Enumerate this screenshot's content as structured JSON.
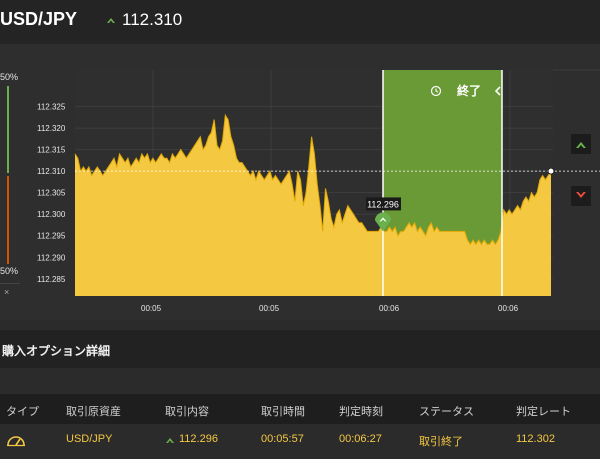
{
  "header": {
    "pair": "USD/JPY",
    "direction_icon": "up-arrow-icon",
    "current_rate": "112.310"
  },
  "gauge": {
    "top_label": "50%",
    "bottom_label": "50%",
    "close_label": "×",
    "high_color": "#6ab04c",
    "low_color": "#d35400"
  },
  "chart_data": {
    "type": "area",
    "y_ticks": [
      "112.325",
      "112.320",
      "112.315",
      "112.310",
      "112.305",
      "112.300",
      "112.295",
      "112.290",
      "112.285"
    ],
    "x_ticks": [
      "00:05",
      "00:05",
      "00:06",
      "00:06"
    ],
    "ylim": [
      112.281,
      112.3335
    ],
    "current_level": 112.31,
    "entry_marker_label": "112.296",
    "entry_value": 112.296,
    "expiry_panel_label": "終了",
    "area_color": "#f5c842",
    "expiry_panel_color": "#6a9a36",
    "series": [
      {
        "values": [
          112.314,
          112.313,
          112.31,
          112.311,
          112.31,
          112.311,
          112.309,
          112.31,
          112.311,
          112.31,
          112.309,
          112.31,
          112.311,
          112.312,
          112.313,
          112.311,
          112.314,
          112.313,
          112.312,
          112.313,
          112.311,
          112.312,
          112.313,
          112.312,
          112.314,
          112.313,
          112.314,
          112.312,
          112.313,
          112.312,
          112.313,
          112.314,
          112.313,
          112.313,
          112.312,
          112.314,
          112.313,
          112.314,
          112.315,
          112.314,
          112.313,
          112.314,
          112.315,
          112.316,
          112.317,
          112.318,
          112.315,
          112.316,
          112.318,
          112.319,
          112.322,
          112.316,
          112.315,
          112.317,
          112.323,
          112.322,
          112.318,
          112.316,
          112.313,
          112.312,
          112.312,
          112.311,
          112.31,
          112.309,
          112.31,
          112.308,
          112.31,
          112.309,
          112.308,
          112.309,
          112.31,
          112.308,
          112.309,
          112.308,
          112.307,
          112.308,
          112.309,
          112.31,
          112.307,
          112.303,
          112.31,
          112.308,
          112.302,
          112.305,
          112.311,
          112.318,
          112.314,
          112.307,
          112.302,
          112.296,
          112.306,
          112.303,
          112.299,
          112.297,
          112.3,
          112.301,
          112.298,
          112.3,
          112.302,
          112.301,
          112.3,
          112.299,
          112.298,
          112.298,
          112.297,
          112.296,
          112.296,
          112.296,
          112.296,
          112.296,
          112.297,
          112.296,
          112.296,
          112.297,
          112.296,
          112.297,
          112.295,
          112.296,
          112.296,
          112.297,
          112.298,
          112.297,
          112.298,
          112.296,
          112.297,
          112.296,
          112.295,
          112.297,
          112.298,
          112.296,
          112.297,
          112.296,
          112.296,
          112.296,
          112.296,
          112.296,
          112.296,
          112.296,
          112.296,
          112.296,
          112.296,
          112.294,
          112.293,
          112.294,
          112.293,
          112.294,
          112.293,
          112.294,
          112.293,
          112.293,
          112.294,
          112.293,
          112.294,
          112.296,
          112.301,
          112.3,
          112.301,
          112.3,
          112.301,
          112.302,
          112.301,
          112.303,
          112.304,
          112.303,
          112.305,
          112.304,
          112.305,
          112.308,
          112.309,
          112.308,
          112.309,
          112.31
        ]
      }
    ]
  },
  "side_buttons": {
    "up_icon": "up-arrow-icon",
    "down_icon": "down-arrow-icon",
    "up_color": "#6ab04c",
    "down_color": "#e74c3c"
  },
  "details": {
    "title": "購入オプション詳細",
    "columns": [
      "タイプ",
      "取引原資産",
      "取引内容",
      "取引時間",
      "判定時刻",
      "ステータス",
      "判定レート"
    ],
    "row": {
      "type_icon": "gauge-icon",
      "asset": "USD/JPY",
      "direction_icon": "up-arrow-icon",
      "content": "112.296",
      "trade_time": "00:05:57",
      "judge_time": "00:06:27",
      "status": "取引終了",
      "judge_rate": "112.302"
    }
  }
}
